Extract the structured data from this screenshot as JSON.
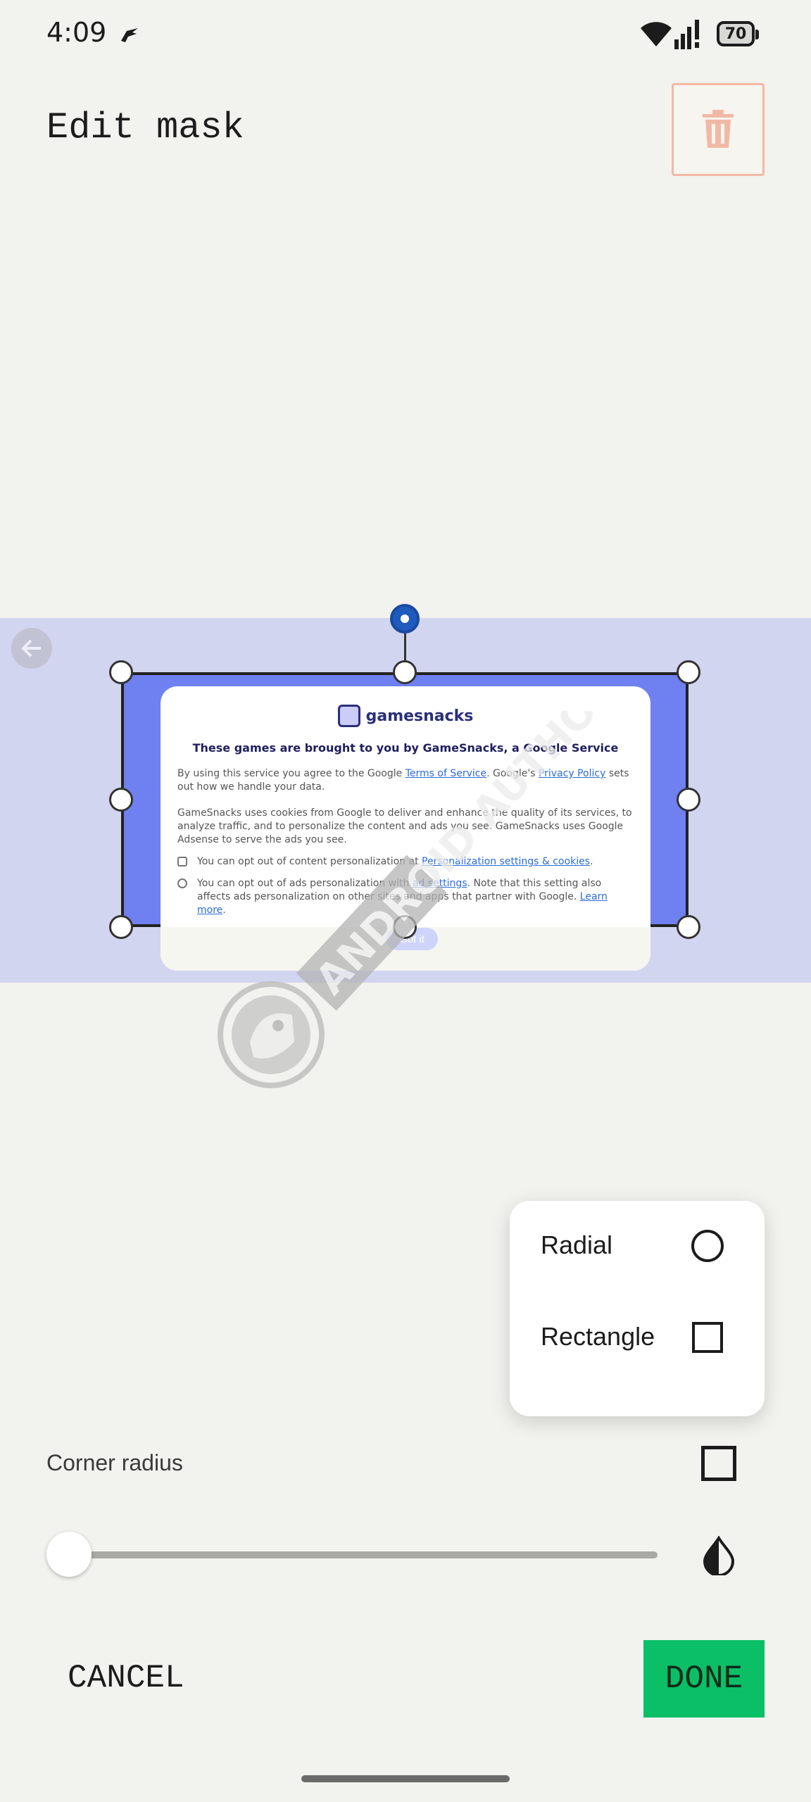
{
  "status_bar": {
    "time": "4:09",
    "battery": "70"
  },
  "header": {
    "title": "Edit mask"
  },
  "dialog": {
    "brand": "gamesnacks",
    "heading": "These games are brought to you by GameSnacks, a Google Service",
    "para1_a": "By using this service you agree to the Google ",
    "para1_link1": "Terms of Service",
    "para1_b": ". Google's ",
    "para1_link2": "Privacy Policy",
    "para1_c": " sets out how we handle your data.",
    "para2": "GameSnacks uses cookies from Google to deliver and enhance the quality of its services, to analyze traffic, and to personalize the content and ads you see. GameSnacks uses Google Adsense to serve the ads you see.",
    "row1_a": "You can opt out of content personalization at ",
    "row1_link": "Personalization settings & cookies",
    "row1_b": ".",
    "row2_a": "You can opt out of ads personalization with ",
    "row2_link": "ad settings",
    "row2_b": ". Note that this setting also affects ads personalization on other sites and apps that partner with Google. ",
    "row2_link2": "Learn more",
    "row2_c": ".",
    "button": "Got it"
  },
  "watermark": {
    "text": "ANDROID AUTHORITY"
  },
  "shape_menu": {
    "items": [
      {
        "label": "Radial",
        "icon": "circle-icon"
      },
      {
        "label": "Rectangle",
        "icon": "square-icon"
      }
    ]
  },
  "corner_radius": {
    "label": "Corner radius",
    "value": 0
  },
  "actions": {
    "cancel": "CANCEL",
    "done": "DONE"
  },
  "colors": {
    "accent": "#0bbf66",
    "mask": "#6f80f0",
    "delete_border": "#f1b9a5",
    "handle_blue": "#1f5bbd"
  }
}
